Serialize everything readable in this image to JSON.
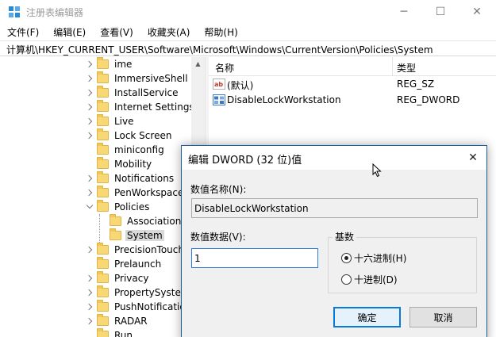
{
  "window": {
    "title": "注册表编辑器",
    "min_glyph": "─",
    "max_glyph": "☐",
    "close_glyph": "✕"
  },
  "menu": [
    "文件(F)",
    "编辑(E)",
    "查看(V)",
    "收藏夹(A)",
    "帮助(H)"
  ],
  "address": "计算机\\HKEY_CURRENT_USER\\Software\\Microsoft\\Windows\\CurrentVersion\\Policies\\System",
  "tree": {
    "items": [
      {
        "label": "ime"
      },
      {
        "label": "ImmersiveShell"
      },
      {
        "label": "InstallService"
      },
      {
        "label": "Internet Settings"
      },
      {
        "label": "Live"
      },
      {
        "label": "Lock Screen"
      },
      {
        "label": "miniconfig"
      },
      {
        "label": "Mobility"
      },
      {
        "label": "Notifications"
      },
      {
        "label": "PenWorkspace"
      },
      {
        "label": "Policies"
      },
      {
        "label": "Associations"
      },
      {
        "label": "System"
      },
      {
        "label": "PrecisionTouch"
      },
      {
        "label": "Prelaunch"
      },
      {
        "label": "Privacy"
      },
      {
        "label": "PropertySystem"
      },
      {
        "label": "PushNotification"
      },
      {
        "label": "RADAR"
      },
      {
        "label": "Run"
      }
    ],
    "selected": "System"
  },
  "list": {
    "columns": {
      "name": "名称",
      "type": "类型"
    },
    "rows": [
      {
        "name": "(默认)",
        "type": "REG_SZ",
        "icon": "string-value-icon"
      },
      {
        "name": "DisableLockWorkstation",
        "type": "REG_DWORD",
        "icon": "dword-value-icon"
      }
    ]
  },
  "dialog": {
    "title": "编辑 DWORD (32 位)值",
    "close_glyph": "✕",
    "value_name_label": "数值名称(N):",
    "value_name": "DisableLockWorkstation",
    "value_data_label": "数值数据(V):",
    "value_data": "1",
    "base_label": "基数",
    "radio_hex": "十六进制(H)",
    "radio_dec": "十进制(D)",
    "selected_base": "hex",
    "ok_label": "确定",
    "cancel_label": "取消"
  },
  "colors": {
    "accent": "#0a78d7",
    "folder": "#f8d775",
    "dialog_bg": "#f0f0f0"
  }
}
